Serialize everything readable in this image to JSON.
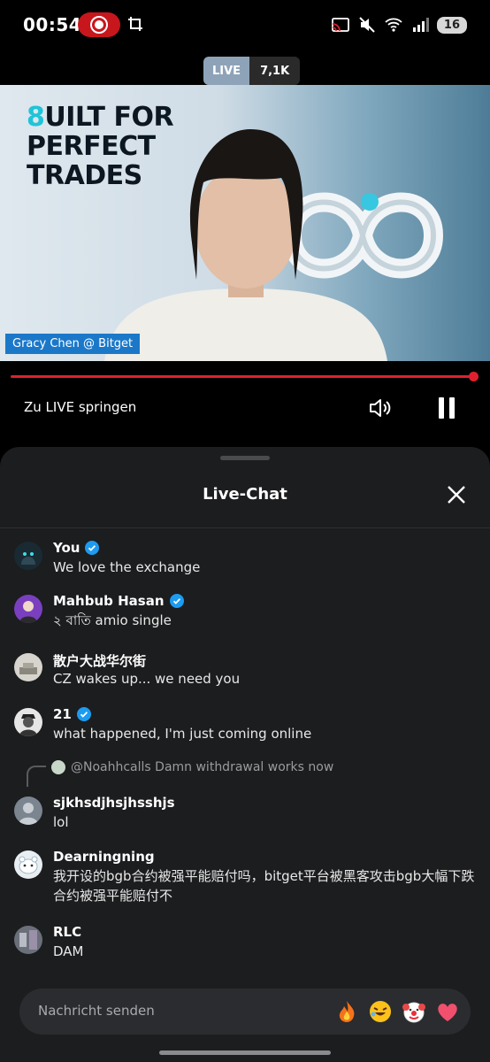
{
  "status_bar": {
    "time": "00:54",
    "battery": "16",
    "icons": [
      "record-icon",
      "crop-icon",
      "cast-icon",
      "mute-icon",
      "wifi-icon",
      "signal-icon"
    ]
  },
  "live_badge": {
    "label": "LIVE",
    "viewers": "7,1K"
  },
  "video": {
    "headline_accent": "8",
    "headline_line1": "UILT FOR",
    "headline_line2": "PERFECT",
    "headline_line3": "TRADES",
    "lower_third": "Gracy Chen @ Bitget"
  },
  "player": {
    "jump_live": "Zu LIVE springen",
    "progress": 1.0
  },
  "chat": {
    "title": "Live-Chat",
    "messages": [
      {
        "name": "You",
        "verified": true,
        "text": "We love the exchange",
        "avatar_color": "#1a2a33"
      },
      {
        "name": "Mahbub Hasan",
        "verified": true,
        "text": "২ বাতি amio single",
        "avatar_color": "#7a3fbf"
      },
      {
        "name": "散户大战华尔街",
        "verified": false,
        "text": "CZ wakes up... we need you",
        "avatar_color": "#9a9a90"
      },
      {
        "name": "21",
        "verified": true,
        "text": "what happened, I'm just coming online",
        "avatar_color": "#cfcfcf"
      },
      {
        "name": "sjkhsdjhsjhsshjs",
        "verified": false,
        "text": "lol",
        "avatar_color": "#7b8590"
      },
      {
        "name": "Dearningning",
        "verified": false,
        "text": "我开设的bgb合约被强平能赔付吗，bitget平台被黑客攻击bgb大幅下跌合约被强平能赔付不",
        "avatar_color": "#e8eef2"
      },
      {
        "name": "RLC",
        "verified": false,
        "text": "DAM",
        "avatar_color": "#6a6f7a"
      }
    ],
    "reply_context": "@Noahhcalls Damn withdrawal works now"
  },
  "input": {
    "placeholder": "Nachricht senden",
    "emojis": [
      "🔥",
      "🤣",
      "🤡",
      "❤️"
    ]
  },
  "colors": {
    "accent_red": "#e0202e",
    "verified_blue": "#1d9bf0",
    "sheet_bg": "#1c1d1f"
  }
}
